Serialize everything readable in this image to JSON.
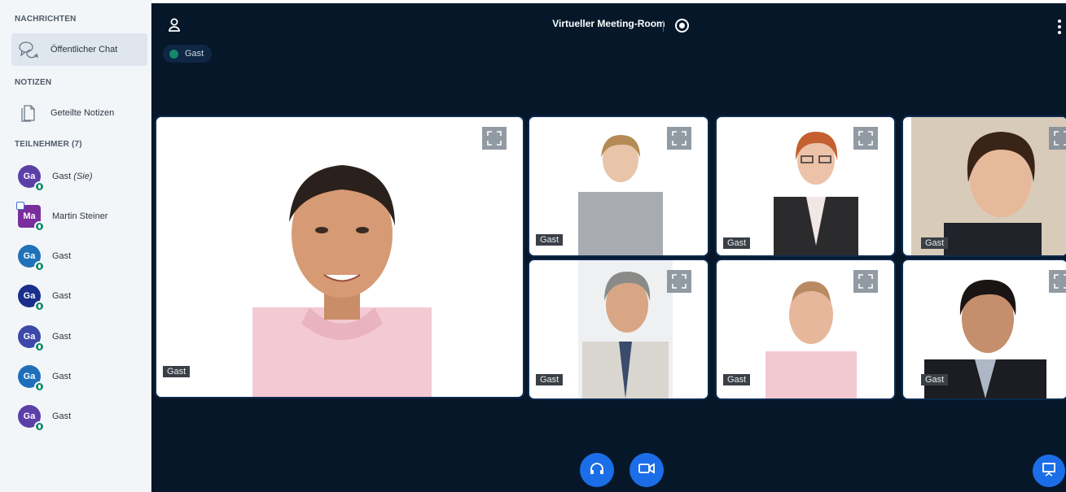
{
  "sidebar": {
    "messages_title": "NACHRICHTEN",
    "public_chat": "Öffentlicher Chat",
    "notes_title": "NOTIZEN",
    "shared_notes": "Geteilte Notizen",
    "participants_title": "TEILNEHMER (7)",
    "participants": [
      {
        "initials": "Ga",
        "name": "Gast",
        "suffix": "(Sie)",
        "color": "#5b3fa8"
      },
      {
        "initials": "Ma",
        "name": "Martin Steiner",
        "suffix": "",
        "color": "#7a2e9c"
      },
      {
        "initials": "Ga",
        "name": "Gast",
        "suffix": "",
        "color": "#1f72b8"
      },
      {
        "initials": "Ga",
        "name": "Gast",
        "suffix": "",
        "color": "#1a2f8c"
      },
      {
        "initials": "Ga",
        "name": "Gast",
        "suffix": "",
        "color": "#3c49a8"
      },
      {
        "initials": "Ga",
        "name": "Gast",
        "suffix": "",
        "color": "#1e6fba"
      },
      {
        "initials": "Ga",
        "name": "Gast",
        "suffix": "",
        "color": "#5b3fa8"
      }
    ]
  },
  "header": {
    "title": "Virtueller Meeting-Room",
    "talking_indicator": "Gast"
  },
  "videos": [
    {
      "name": "Gast"
    },
    {
      "name": "Gast"
    },
    {
      "name": "Gast"
    },
    {
      "name": "Gast"
    },
    {
      "name": "Gast"
    },
    {
      "name": "Gast"
    },
    {
      "name": "Gast"
    }
  ],
  "colors": {
    "main_background": "#06172a",
    "accent": "#1b6ee8",
    "mic_active": "#0f8a6a"
  },
  "icons": {
    "chat": "chat-bubbles-icon",
    "notes": "notes-icon",
    "user": "user-icon",
    "record": "record-icon",
    "more": "kebab-menu-icon",
    "fullscreen": "fullscreen-icon",
    "audio": "headphones-icon",
    "video": "camera-icon",
    "presentation": "presentation-icon"
  }
}
